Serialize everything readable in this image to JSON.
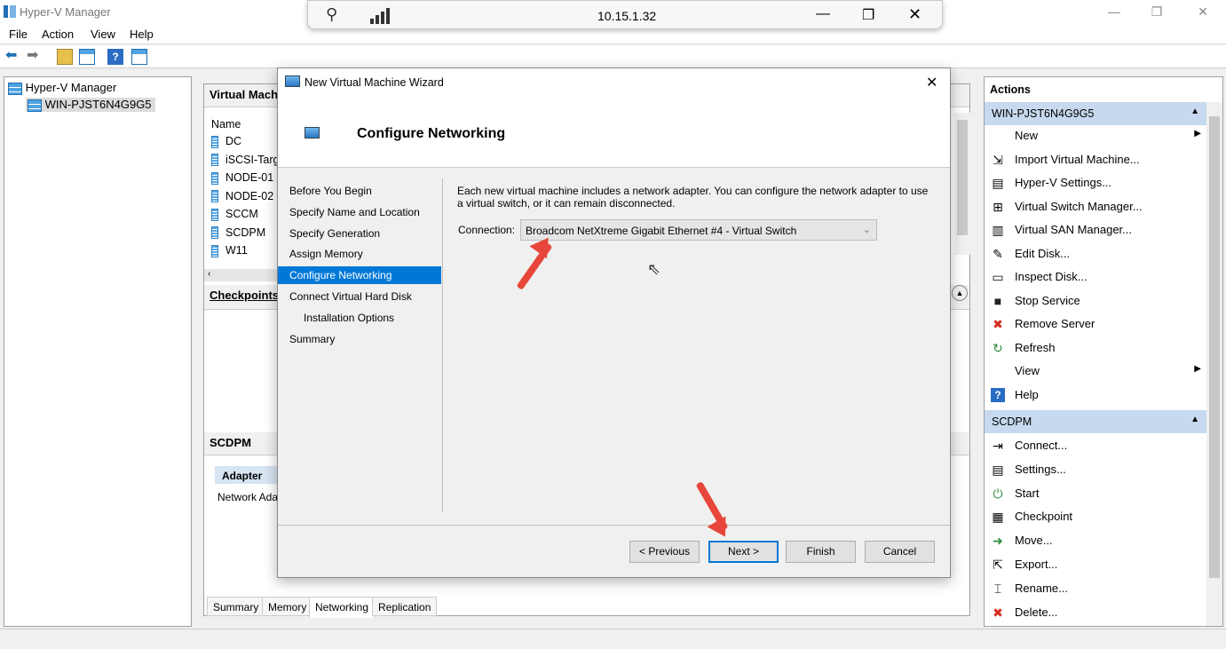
{
  "window": {
    "title": "Hyper-V Manager",
    "min": "—",
    "max": "❐",
    "close": "✕"
  },
  "menu": {
    "file": "File",
    "action": "Action",
    "view": "View",
    "help": "Help"
  },
  "rdp": {
    "ip": "10.15.1.32",
    "pin": "⚲",
    "min": "—",
    "restore": "❐",
    "close": "✕"
  },
  "tree": {
    "root": "Hyper-V Manager",
    "server": "WIN-PJST6N4G9G5"
  },
  "center": {
    "vm_panel_title": "Virtual Mach",
    "col_name": "Name",
    "vms": [
      "DC",
      "iSCSI-Targ",
      "NODE-01",
      "NODE-02",
      "SCCM",
      "SCDPM",
      "W11"
    ],
    "checkpoints_title": "Checkpoints",
    "detail_title": "SCDPM",
    "adapter_header": "Adapter",
    "adapter_row": "Network Ada",
    "tabs": [
      "Summary",
      "Memory",
      "Networking",
      "Replication"
    ]
  },
  "actions": {
    "title": "Actions",
    "server_header": "WIN-PJST6N4G9G5",
    "server_items": [
      {
        "label": "New",
        "icon": "blank",
        "submenu": true
      },
      {
        "label": "Import Virtual Machine...",
        "icon": "import-icon"
      },
      {
        "label": "Hyper-V Settings...",
        "icon": "settings-icon"
      },
      {
        "label": "Virtual Switch Manager...",
        "icon": "switch-icon"
      },
      {
        "label": "Virtual SAN Manager...",
        "icon": "san-icon"
      },
      {
        "label": "Edit Disk...",
        "icon": "edit-disk-icon"
      },
      {
        "label": "Inspect Disk...",
        "icon": "inspect-disk-icon"
      },
      {
        "label": "Stop Service",
        "icon": "stop-icon"
      },
      {
        "label": "Remove Server",
        "icon": "remove-icon"
      },
      {
        "label": "Refresh",
        "icon": "refresh-icon"
      },
      {
        "label": "View",
        "icon": "blank",
        "submenu": true
      },
      {
        "label": "Help",
        "icon": "help-icon"
      }
    ],
    "vm_header": "SCDPM",
    "vm_items": [
      {
        "label": "Connect...",
        "icon": "connect-icon"
      },
      {
        "label": "Settings...",
        "icon": "vm-settings-icon"
      },
      {
        "label": "Start",
        "icon": "start-icon"
      },
      {
        "label": "Checkpoint",
        "icon": "checkpoint-icon"
      },
      {
        "label": "Move...",
        "icon": "move-icon"
      },
      {
        "label": "Export...",
        "icon": "export-icon"
      },
      {
        "label": "Rename...",
        "icon": "rename-icon"
      },
      {
        "label": "Delete...",
        "icon": "delete-icon"
      }
    ]
  },
  "wizard": {
    "title": "New Virtual Machine Wizard",
    "page_title": "Configure Networking",
    "steps": [
      "Before You Begin",
      "Specify Name and Location",
      "Specify Generation",
      "Assign Memory",
      "Configure Networking",
      "Connect Virtual Hard Disk",
      "Installation Options",
      "Summary"
    ],
    "selected_step": 4,
    "description": "Each new virtual machine includes a network adapter. You can configure the network adapter to use a virtual switch, or it can remain disconnected.",
    "connection_label": "Connection:",
    "connection_value": "Broadcom NetXtreme Gigabit Ethernet #4 - Virtual Switch",
    "buttons": {
      "previous": "< Previous",
      "next": "Next >",
      "finish": "Finish",
      "cancel": "Cancel"
    }
  },
  "colors": {
    "selection": "#0078d7",
    "action_header": "#c6d9ee",
    "arrow": "#e8463a"
  }
}
